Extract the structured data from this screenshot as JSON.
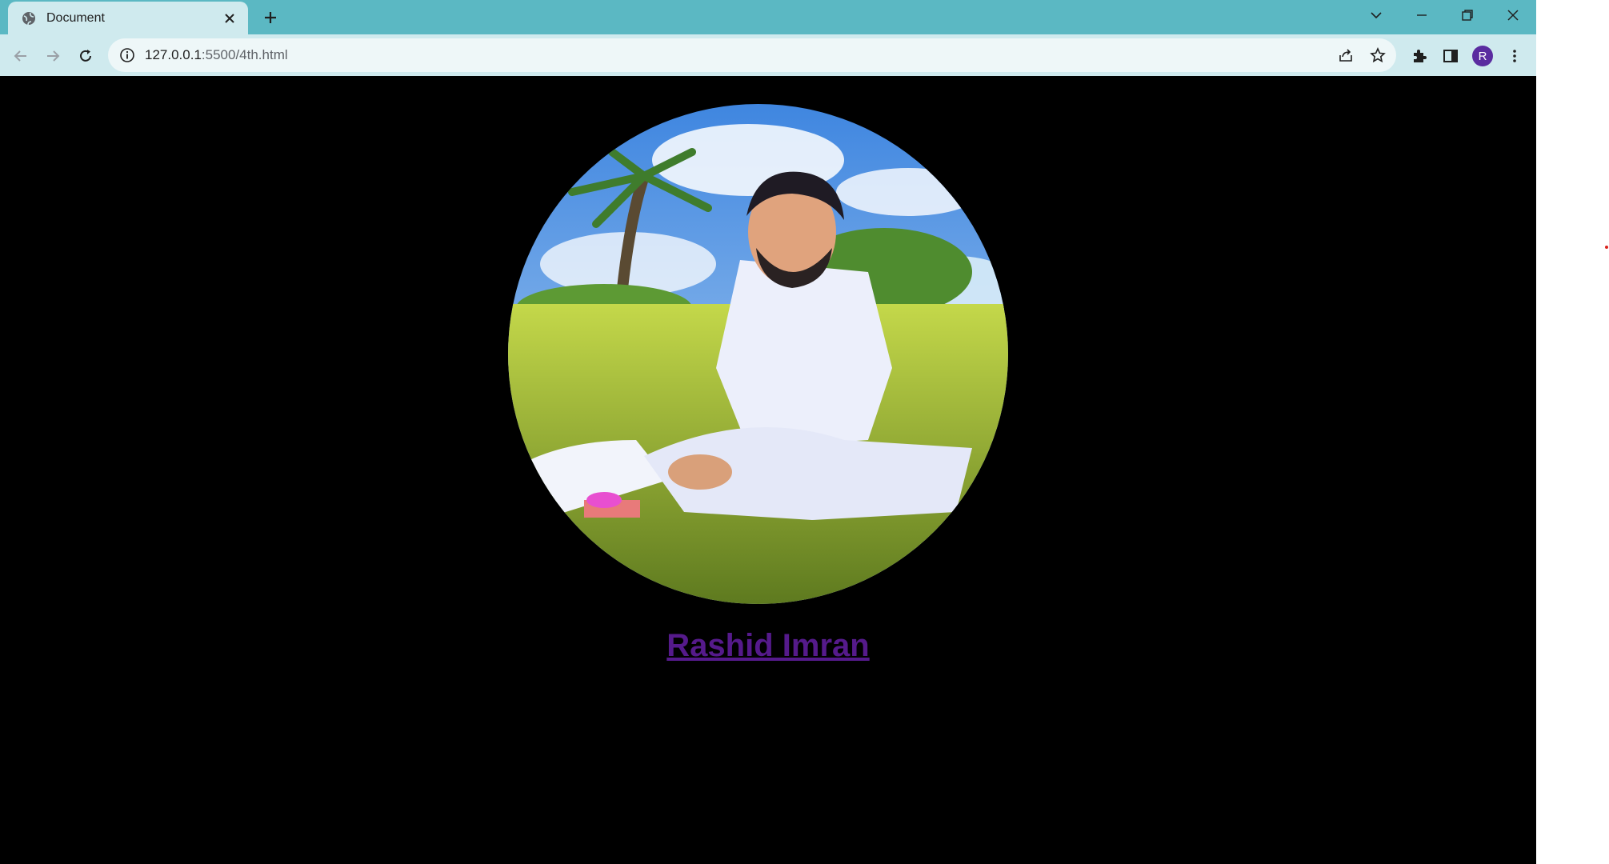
{
  "browser": {
    "tab": {
      "title": "Document"
    },
    "address": {
      "host": "127.0.0.1",
      "path": ":5500/4th.html"
    },
    "profile_initial": "R",
    "icons": {
      "tab_favicon": "globe-icon",
      "tab_close": "close-icon",
      "new_tab": "plus-icon",
      "tab_search": "chevron-down-icon",
      "minimize": "minimize-icon",
      "restore": "restore-icon",
      "close_window": "close-icon",
      "back": "arrow-left-icon",
      "forward": "arrow-right-icon",
      "reload": "reload-icon",
      "site_info": "info-icon",
      "share": "share-icon",
      "bookmark": "star-icon",
      "extensions": "puzzle-icon",
      "side_panel": "side-panel-icon",
      "menu": "kebab-menu-icon"
    }
  },
  "page": {
    "name_link": "Rashid Imran",
    "link_color": "#551a8b",
    "background": "#000000"
  }
}
